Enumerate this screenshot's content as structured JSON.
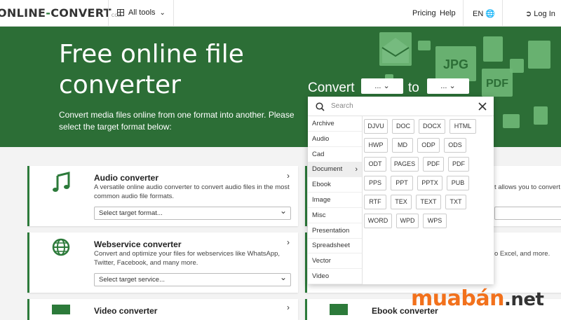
{
  "header": {
    "logo_main": "ONLINE",
    "logo_dash": "-",
    "logo_end": "CONVERT",
    "logo_tld": "COM",
    "all_tools": "All tools",
    "pricing": "Pricing",
    "help": "Help",
    "lang": "EN",
    "login": "Log In"
  },
  "hero": {
    "title": "Free online file converter",
    "subtitle": "Convert media files online from one format into another. Please select the target format below:",
    "convert_label": "Convert",
    "from_value": "...",
    "to_label": "to",
    "to_value": "...",
    "deco_jpg": "JPG",
    "deco_pdf": "PDF"
  },
  "dropdown": {
    "search_placeholder": "Search",
    "categories": [
      "Archive",
      "Audio",
      "Cad",
      "Document",
      "Ebook",
      "Image",
      "Misc",
      "Presentation",
      "Spreadsheet",
      "Vector",
      "Video"
    ],
    "active_category": "Document",
    "formats": [
      "DJVU",
      "DOC",
      "DOCX",
      "HTML",
      "HWP",
      "MD",
      "ODP",
      "ODS",
      "ODT",
      "PAGES",
      "PDF",
      "PDF",
      "PPS",
      "PPT",
      "PPTX",
      "PUB",
      "RTF",
      "TEX",
      "TEXT",
      "TXT",
      "WORD",
      "WPD",
      "WPS"
    ]
  },
  "cards": {
    "audio": {
      "title": "Audio converter",
      "desc": "A versatile online audio converter to convert audio files in the most common audio file formats.",
      "select": "Select target format..."
    },
    "webservice": {
      "title": "Webservice converter",
      "desc": "Convert and optimize your files for webservices like WhatsApp, Twitter, Facebook, and many more.",
      "select": "Select target service..."
    },
    "video": {
      "title": "Video converter"
    },
    "right1_text": "t allows you to convert",
    "right2_text": "o Excel, and more.",
    "ebook": {
      "title": "Ebook converter"
    }
  },
  "watermark": {
    "brand": "muabán",
    "tld": ".net"
  }
}
